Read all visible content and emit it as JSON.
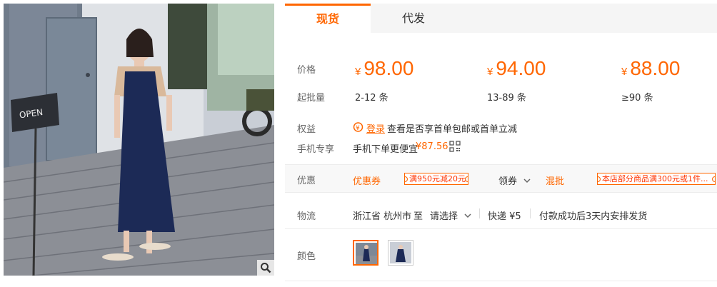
{
  "tabs": [
    {
      "label": "现货",
      "active": true
    },
    {
      "label": "代发",
      "active": false
    }
  ],
  "pricing": {
    "price_label": "价格",
    "min_qty_label": "起批量",
    "currency": "¥",
    "tiers": [
      {
        "price": "98.00",
        "qty": "2-12 条"
      },
      {
        "price": "94.00",
        "qty": "13-89 条"
      },
      {
        "price": "88.00",
        "qty": "≥90 条"
      }
    ]
  },
  "benefits": {
    "label": "权益",
    "login_link": "登录",
    "text": "查看是否享首单包邮或首单立减"
  },
  "mobile": {
    "label": "手机专享",
    "text": "手机下单更便宜",
    "price": "¥87.56"
  },
  "discount": {
    "label": "优惠",
    "coupon_link": "优惠券",
    "coupon1": "满950元减20元",
    "get_coupon": "领券",
    "mixed_batch": "混批",
    "coupon2": "本店部分商品满300元或1件..."
  },
  "logistics": {
    "label": "物流",
    "from": "浙江省 杭州市",
    "to_word": "至",
    "select": "请选择",
    "express": "快递 ¥5",
    "shipping_note": "付款成功后3天内安排发货"
  },
  "color": {
    "label": "颜色"
  },
  "photo": {
    "sign_text": "OPEN"
  },
  "colors": {
    "accent": "#ff6600",
    "dress": "#1c2a56"
  }
}
